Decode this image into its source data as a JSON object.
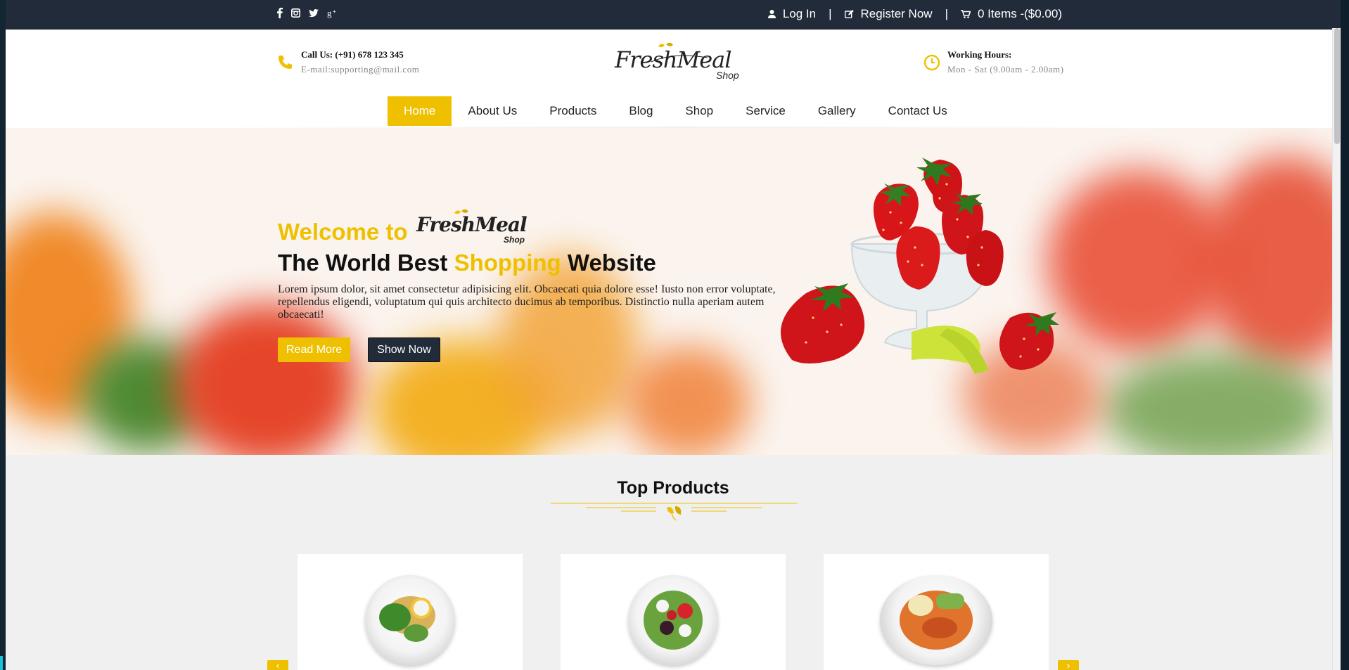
{
  "topbar": {
    "social": [
      "facebook-icon",
      "instagram-icon",
      "twitter-icon",
      "google-plus-icon"
    ],
    "login": "Log In",
    "register": "Register Now",
    "cart": "0 Items -($0.00)"
  },
  "header": {
    "call": "Call Us: (+91) 678 123 345",
    "email": "E-mail:supporting@mail.com",
    "hours_label": "Working Hours:",
    "hours_value": "Mon - Sat (9.00am - 2.00am)",
    "logo_main": "FreshMeal",
    "logo_sub": "Shop"
  },
  "nav": {
    "items": [
      "Home",
      "About Us",
      "Products",
      "Blog",
      "Shop",
      "Service",
      "Gallery",
      "Contact Us"
    ],
    "active": "Home"
  },
  "hero": {
    "welcome": "Welcome to",
    "tagline_pre": "The World Best ",
    "tagline_hl": "Shopping",
    "tagline_post": " Website",
    "description": "Lorem ipsum dolor, sit amet consectetur adipisicing elit. Obcaecati quia dolore esse! Iusto non error voluptate, repellendus eligendi, voluptatum qui quis architecto ducimus ab temporibus. Distinctio nulla aperiam autem obcaecati!",
    "read_more": "Read More",
    "show_now": "Show Now"
  },
  "products": {
    "title": "Top Products",
    "prev": "‹",
    "next": "›"
  },
  "colors": {
    "accent": "#efc000",
    "dark": "#222b39"
  }
}
